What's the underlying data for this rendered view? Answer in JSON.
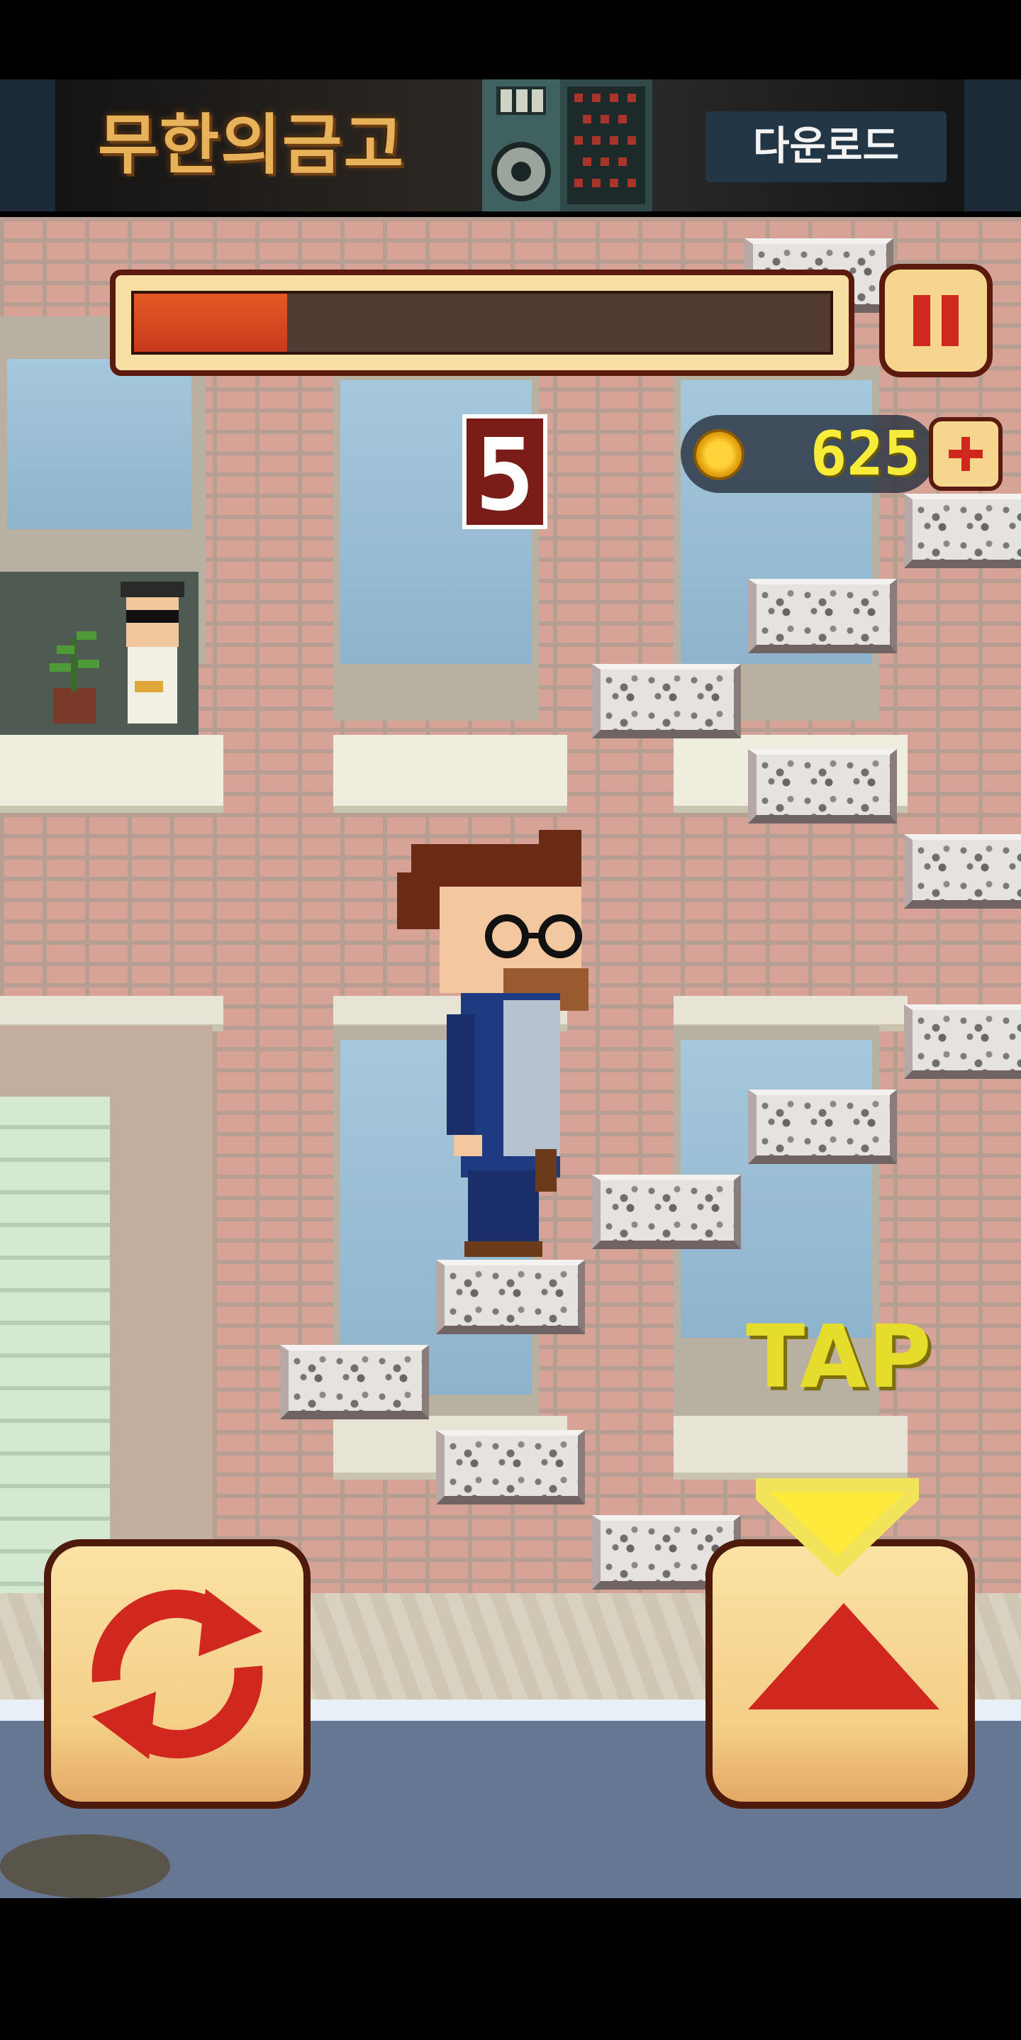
{
  "ad": {
    "title": "무한의금고",
    "download_label": "다운로드"
  },
  "hud": {
    "timer_fraction": 0.22,
    "score": "5",
    "coins": "625",
    "tap_hint": "TAP"
  },
  "icons": {
    "pause": "pause-icon",
    "coin": "coin-icon",
    "add": "plus-icon",
    "switch": "switch-direction-icon",
    "climb": "up-arrow-icon"
  },
  "colors": {
    "accent_red": "#d0271f",
    "button_face": "#f6d58e",
    "button_border": "#5a1a0e",
    "timer_fill": "#e45a25",
    "coin_text": "#f7ec3a",
    "tap_text": "#e6dc2b"
  }
}
